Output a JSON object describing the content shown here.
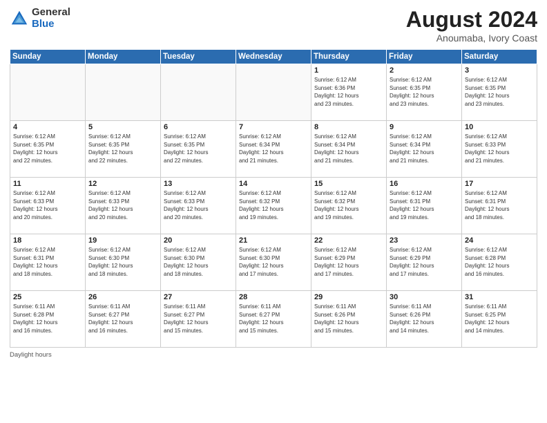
{
  "logo": {
    "general": "General",
    "blue": "Blue"
  },
  "title": {
    "month_year": "August 2024",
    "location": "Anoumaba, Ivory Coast"
  },
  "days_of_week": [
    "Sunday",
    "Monday",
    "Tuesday",
    "Wednesday",
    "Thursday",
    "Friday",
    "Saturday"
  ],
  "footer": {
    "daylight_label": "Daylight hours"
  },
  "weeks": [
    [
      {
        "day": "",
        "info": ""
      },
      {
        "day": "",
        "info": ""
      },
      {
        "day": "",
        "info": ""
      },
      {
        "day": "",
        "info": ""
      },
      {
        "day": "1",
        "info": "Sunrise: 6:12 AM\nSunset: 6:36 PM\nDaylight: 12 hours\nand 23 minutes."
      },
      {
        "day": "2",
        "info": "Sunrise: 6:12 AM\nSunset: 6:35 PM\nDaylight: 12 hours\nand 23 minutes."
      },
      {
        "day": "3",
        "info": "Sunrise: 6:12 AM\nSunset: 6:35 PM\nDaylight: 12 hours\nand 23 minutes."
      }
    ],
    [
      {
        "day": "4",
        "info": "Sunrise: 6:12 AM\nSunset: 6:35 PM\nDaylight: 12 hours\nand 22 minutes."
      },
      {
        "day": "5",
        "info": "Sunrise: 6:12 AM\nSunset: 6:35 PM\nDaylight: 12 hours\nand 22 minutes."
      },
      {
        "day": "6",
        "info": "Sunrise: 6:12 AM\nSunset: 6:35 PM\nDaylight: 12 hours\nand 22 minutes."
      },
      {
        "day": "7",
        "info": "Sunrise: 6:12 AM\nSunset: 6:34 PM\nDaylight: 12 hours\nand 21 minutes."
      },
      {
        "day": "8",
        "info": "Sunrise: 6:12 AM\nSunset: 6:34 PM\nDaylight: 12 hours\nand 21 minutes."
      },
      {
        "day": "9",
        "info": "Sunrise: 6:12 AM\nSunset: 6:34 PM\nDaylight: 12 hours\nand 21 minutes."
      },
      {
        "day": "10",
        "info": "Sunrise: 6:12 AM\nSunset: 6:33 PM\nDaylight: 12 hours\nand 21 minutes."
      }
    ],
    [
      {
        "day": "11",
        "info": "Sunrise: 6:12 AM\nSunset: 6:33 PM\nDaylight: 12 hours\nand 20 minutes."
      },
      {
        "day": "12",
        "info": "Sunrise: 6:12 AM\nSunset: 6:33 PM\nDaylight: 12 hours\nand 20 minutes."
      },
      {
        "day": "13",
        "info": "Sunrise: 6:12 AM\nSunset: 6:33 PM\nDaylight: 12 hours\nand 20 minutes."
      },
      {
        "day": "14",
        "info": "Sunrise: 6:12 AM\nSunset: 6:32 PM\nDaylight: 12 hours\nand 19 minutes."
      },
      {
        "day": "15",
        "info": "Sunrise: 6:12 AM\nSunset: 6:32 PM\nDaylight: 12 hours\nand 19 minutes."
      },
      {
        "day": "16",
        "info": "Sunrise: 6:12 AM\nSunset: 6:31 PM\nDaylight: 12 hours\nand 19 minutes."
      },
      {
        "day": "17",
        "info": "Sunrise: 6:12 AM\nSunset: 6:31 PM\nDaylight: 12 hours\nand 18 minutes."
      }
    ],
    [
      {
        "day": "18",
        "info": "Sunrise: 6:12 AM\nSunset: 6:31 PM\nDaylight: 12 hours\nand 18 minutes."
      },
      {
        "day": "19",
        "info": "Sunrise: 6:12 AM\nSunset: 6:30 PM\nDaylight: 12 hours\nand 18 minutes."
      },
      {
        "day": "20",
        "info": "Sunrise: 6:12 AM\nSunset: 6:30 PM\nDaylight: 12 hours\nand 18 minutes."
      },
      {
        "day": "21",
        "info": "Sunrise: 6:12 AM\nSunset: 6:30 PM\nDaylight: 12 hours\nand 17 minutes."
      },
      {
        "day": "22",
        "info": "Sunrise: 6:12 AM\nSunset: 6:29 PM\nDaylight: 12 hours\nand 17 minutes."
      },
      {
        "day": "23",
        "info": "Sunrise: 6:12 AM\nSunset: 6:29 PM\nDaylight: 12 hours\nand 17 minutes."
      },
      {
        "day": "24",
        "info": "Sunrise: 6:12 AM\nSunset: 6:28 PM\nDaylight: 12 hours\nand 16 minutes."
      }
    ],
    [
      {
        "day": "25",
        "info": "Sunrise: 6:11 AM\nSunset: 6:28 PM\nDaylight: 12 hours\nand 16 minutes."
      },
      {
        "day": "26",
        "info": "Sunrise: 6:11 AM\nSunset: 6:27 PM\nDaylight: 12 hours\nand 16 minutes."
      },
      {
        "day": "27",
        "info": "Sunrise: 6:11 AM\nSunset: 6:27 PM\nDaylight: 12 hours\nand 15 minutes."
      },
      {
        "day": "28",
        "info": "Sunrise: 6:11 AM\nSunset: 6:27 PM\nDaylight: 12 hours\nand 15 minutes."
      },
      {
        "day": "29",
        "info": "Sunrise: 6:11 AM\nSunset: 6:26 PM\nDaylight: 12 hours\nand 15 minutes."
      },
      {
        "day": "30",
        "info": "Sunrise: 6:11 AM\nSunset: 6:26 PM\nDaylight: 12 hours\nand 14 minutes."
      },
      {
        "day": "31",
        "info": "Sunrise: 6:11 AM\nSunset: 6:25 PM\nDaylight: 12 hours\nand 14 minutes."
      }
    ]
  ]
}
